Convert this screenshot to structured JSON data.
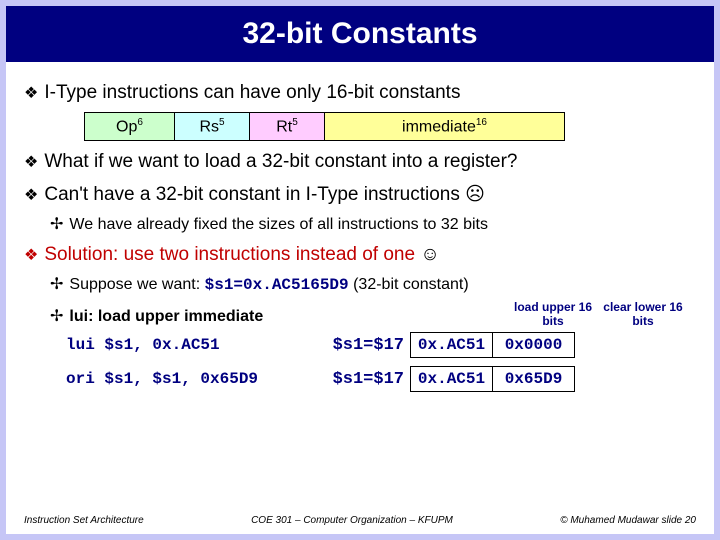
{
  "title": "32-bit Constants",
  "bullets": {
    "b1": "I-Type instructions can have only 16-bit constants",
    "b2": "What if we want to load a 32-bit constant into a register?",
    "b3_prefix": "Can't have a 32-bit constant in I-Type instructions ",
    "b3_emoji": "☹",
    "b4_sub": "We have already fixed the sizes of all instructions to 32 bits",
    "b5_prefix": "Solution: use two instructions instead of one ",
    "b5_emoji": "☺",
    "b6_sub_prefix": "Suppose we want: ",
    "b6_sub_code": "$s1=0x.AC5165D9",
    "b6_sub_suffix": " (32-bit constant)",
    "b7_sub": "lui: load upper immediate"
  },
  "fields": {
    "op": "Op",
    "op_sup": "6",
    "rs": "Rs",
    "rs_sup": "5",
    "rt": "Rt",
    "rt_sup": "5",
    "imm": "immediate",
    "imm_sup": "16"
  },
  "headers": {
    "h1": "load upper 16 bits",
    "h2": "clear lower 16 bits"
  },
  "code": {
    "lui": "lui $s1, 0x.AC51",
    "ori": "ori $s1, $s1, 0x65D9",
    "reg1": "$s1=$17",
    "reg2": "$s1=$17",
    "v11": "0x.AC51",
    "v12": "0x0000",
    "v21": "0x.AC51",
    "v22": "0x65D9"
  },
  "footer": {
    "left": "Instruction Set Architecture",
    "mid": "COE 301 – Computer Organization – KFUPM",
    "right": "© Muhamed Mudawar   slide 20"
  }
}
